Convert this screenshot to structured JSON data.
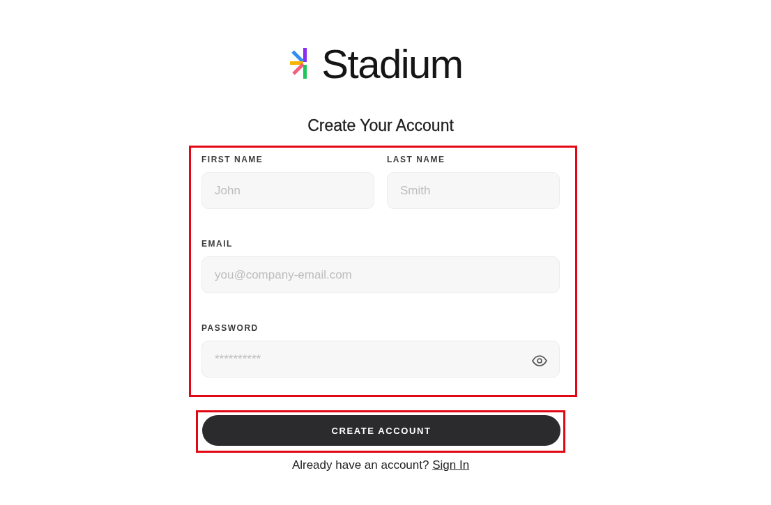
{
  "logo": {
    "name": "Stadium"
  },
  "title": "Create Your Account",
  "form": {
    "highlighted": true,
    "rows": [
      {
        "fields": [
          {
            "kind": "text",
            "label": "FIRST NAME",
            "placeholder": "John"
          },
          {
            "kind": "text",
            "label": "LAST NAME",
            "placeholder": "Smith"
          }
        ]
      },
      {
        "fields": [
          {
            "kind": "text",
            "label": "EMAIL",
            "placeholder": "you@company-email.com"
          }
        ]
      },
      {
        "fields": [
          {
            "kind": "password",
            "label": "PASSWORD",
            "placeholder": "**********"
          }
        ]
      }
    ]
  },
  "submit": {
    "label": "CREATE ACCOUNT",
    "highlighted": true
  },
  "footer": {
    "prompt": "Already have an account?",
    "link": "Sign In"
  }
}
